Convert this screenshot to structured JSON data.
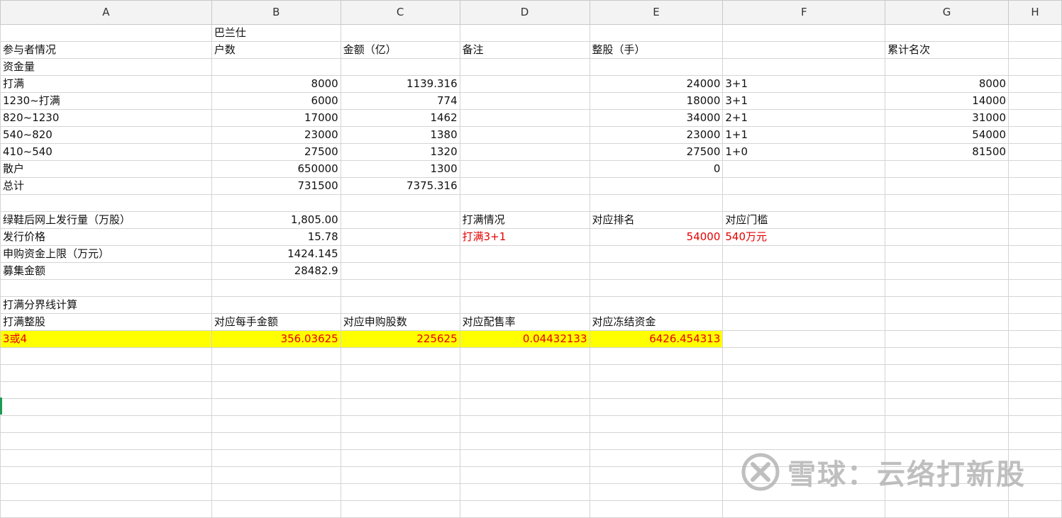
{
  "columns": [
    "A",
    "B",
    "C",
    "D",
    "E",
    "F",
    "G",
    "H"
  ],
  "rows": [
    [
      "",
      "巴兰仕",
      "",
      "",
      "",
      "",
      "",
      ""
    ],
    [
      "参与者情况",
      "户数",
      "金额（亿）",
      "备注",
      "整股（手）",
      "",
      "累计名次",
      ""
    ],
    [
      "资金量",
      "",
      "",
      "",
      "",
      "",
      "",
      ""
    ],
    [
      "打满",
      "8000",
      "1139.316",
      "",
      "24000",
      "3+1",
      "8000",
      ""
    ],
    [
      "1230~打满",
      "6000",
      "774",
      "",
      "18000",
      "3+1",
      "14000",
      ""
    ],
    [
      "820~1230",
      "17000",
      "1462",
      "",
      "34000",
      "2+1",
      "31000",
      ""
    ],
    [
      "540~820",
      "23000",
      "1380",
      "",
      "23000",
      "1+1",
      "54000",
      ""
    ],
    [
      "410~540",
      "27500",
      "1320",
      "",
      "27500",
      "1+0",
      "81500",
      ""
    ],
    [
      "散户",
      "650000",
      "1300",
      "",
      "0",
      "",
      "",
      ""
    ],
    [
      "总计",
      "731500",
      "7375.316",
      "",
      "",
      "",
      "",
      ""
    ],
    [
      "",
      "",
      "",
      "",
      "",
      "",
      "",
      ""
    ],
    [
      "绿鞋后网上发行量（万股）",
      "1,805.00",
      "",
      "打满情况",
      "对应排名",
      "对应门槛",
      "",
      ""
    ],
    [
      "发行价格",
      "15.78",
      "",
      "打满3+1",
      "54000",
      "540万元",
      "",
      ""
    ],
    [
      "申购资金上限（万元）",
      "1424.145",
      "",
      "",
      "",
      "",
      "",
      ""
    ],
    [
      "募集金额",
      "28482.9",
      "",
      "",
      "",
      "",
      "",
      ""
    ],
    [
      "",
      "",
      "",
      "",
      "",
      "",
      "",
      ""
    ],
    [
      "打满分界线计算",
      "",
      "",
      "",
      "",
      "",
      "",
      ""
    ],
    [
      "打满整股",
      "对应每手金额",
      "对应申购股数",
      "对应配售率",
      "对应冻结资金",
      "",
      "",
      ""
    ],
    [
      "3或4",
      "356.03625",
      "225625",
      "0.04432133",
      "6426.454313",
      "",
      "",
      ""
    ],
    [
      "",
      "",
      "",
      "",
      "",
      "",
      "",
      ""
    ],
    [
      "",
      "",
      "",
      "",
      "",
      "",
      "",
      ""
    ],
    [
      "",
      "",
      "",
      "",
      "",
      "",
      "",
      ""
    ],
    [
      "",
      "",
      "",
      "",
      "",
      "",
      "",
      ""
    ],
    [
      "",
      "",
      "",
      "",
      "",
      "",
      "",
      ""
    ],
    [
      "",
      "",
      "",
      "",
      "",
      "",
      "",
      ""
    ],
    [
      "",
      "",
      "",
      "",
      "",
      "",
      "",
      ""
    ],
    [
      "",
      "",
      "",
      "",
      "",
      "",
      "",
      ""
    ],
    [
      "",
      "",
      "",
      "",
      "",
      "",
      "",
      ""
    ],
    [
      "",
      "",
      "",
      "",
      "",
      "",
      "",
      ""
    ]
  ],
  "watermark": {
    "text": "雪球：云络打新股",
    "icon": "snowball-logo-icon"
  },
  "colors": {
    "highlight": "#ffff00",
    "emphasis_text": "#e60000",
    "selection_marker": "#1e9a52"
  }
}
